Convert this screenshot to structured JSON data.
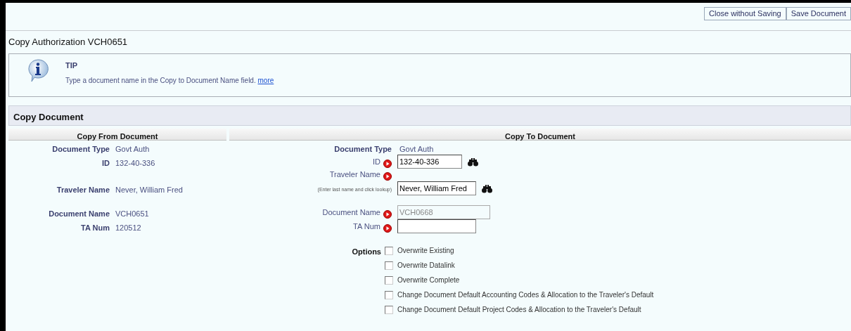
{
  "toolbar": {
    "buttons": [
      "Close without Saving",
      "Save Document"
    ]
  },
  "page_title": "Copy Authorization VCH0651",
  "tip": {
    "title": "TIP",
    "text": "Type a document name in the Copy to Document Name field.",
    "link": "more"
  },
  "section_title": "Copy Document",
  "copy_from": {
    "heading": "Copy From Document",
    "fields": [
      {
        "label": "Document Type",
        "value": "Govt Auth"
      },
      {
        "label": "ID",
        "value": "132-40-336"
      },
      {
        "label": "Traveler Name",
        "value": "Never, William Fred"
      },
      {
        "label": "Document Name",
        "value": "VCH0651"
      },
      {
        "label": "TA Num",
        "value": "120512"
      }
    ]
  },
  "copy_to": {
    "heading": "Copy To Document",
    "fields": [
      {
        "label": "Document Type",
        "kind": "text",
        "value": "Govt Auth",
        "required": false
      },
      {
        "label": "ID",
        "kind": "input",
        "value": "132-40-336",
        "required": true,
        "lookup": true,
        "disabled": false
      },
      {
        "label": "Traveler Name",
        "kind": "input",
        "hint": "(Enter last name and click lookup)",
        "value": "Never, William Fred",
        "required": true,
        "lookup": true,
        "disabled": false
      },
      {
        "label": "Document Name",
        "kind": "input",
        "value": "VCH0668",
        "required": true,
        "lookup": false,
        "disabled": true
      },
      {
        "label": "TA Num",
        "kind": "input",
        "required": true,
        "lookup": false,
        "disabled": false
      }
    ]
  },
  "options": {
    "label": "Options",
    "items": [
      {
        "label": "Overwrite Existing",
        "checked": false
      },
      {
        "label": "Overwrite Datalink",
        "checked": false
      },
      {
        "label": "Overwrite Complete",
        "checked": false
      },
      {
        "label": "Change Document Default Accounting Codes & Allocation to the Traveler's Default",
        "checked": false
      },
      {
        "label": "Change Document Default Project Codes & Allocation to the Traveler's Default",
        "checked": false
      }
    ]
  }
}
